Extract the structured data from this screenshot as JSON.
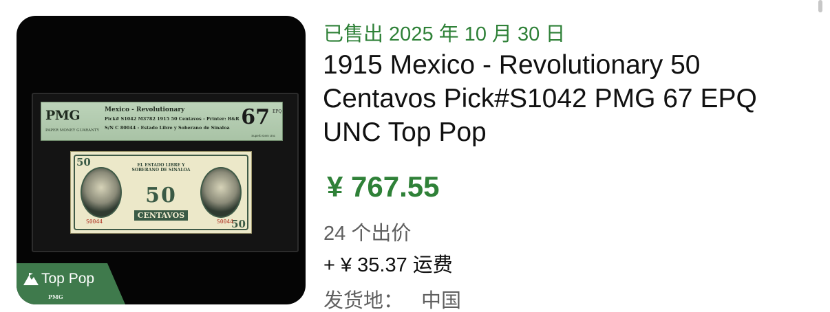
{
  "listing": {
    "sold_status": "已售出 2025 年 10 月 30 日",
    "title": "1915 Mexico - Revolutionary 50 Centavos Pick#S1042 PMG 67 EPQ UNC Top Pop",
    "price": "¥ 767.55",
    "bids": "24 个出价",
    "shipping": "+ ¥ 35.37 运费",
    "location_label": "发货地：",
    "location_value": "中国"
  },
  "image": {
    "badge_text": "Top Pop",
    "badge_brand": "PMG",
    "label": {
      "logo": "PMG",
      "logo_sub": "PAPER MONEY GUARANTY",
      "line1": "Mexico - Revolutionary",
      "line2": "Pick# S1042    M3782    1915    50 Centavos - Printer: B&R",
      "line3": "S/N C 80044 - Estado Libre y Soberano de Sinaloa",
      "grade": "67",
      "grade_suffix": "EPQ",
      "grade_text": "Superb Gem Unc"
    },
    "note": {
      "issuer": "EL ESTADO LIBRE Y SOBERANO DE SINALOA",
      "value": "50",
      "denomination": "CENTAVOS",
      "serial": "S0044"
    }
  },
  "colors": {
    "sold_green": "#2f8138",
    "badge_green": "#3f7a4c",
    "secondary_text": "#5f5f5f"
  }
}
